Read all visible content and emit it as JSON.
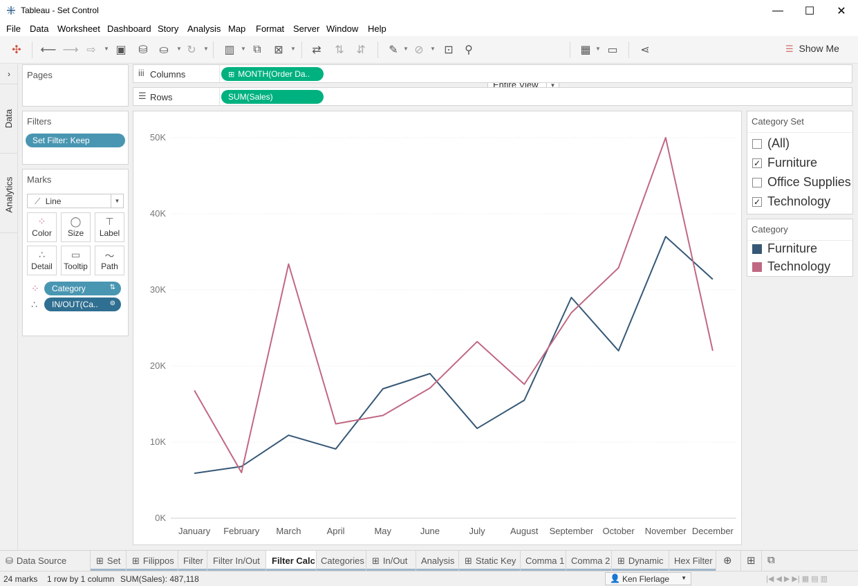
{
  "window": {
    "title": "Tableau - Set Control",
    "controls": {
      "minimize": "—",
      "maximize": "☐",
      "close": "✕"
    }
  },
  "menu": [
    "File",
    "Data",
    "Worksheet",
    "Dashboard",
    "Story",
    "Analysis",
    "Map",
    "Format",
    "Server",
    "Window",
    "Help"
  ],
  "toolbar": {
    "fit_value": "Entire View",
    "show_me": "Show Me"
  },
  "side_tabs": {
    "data": "Data",
    "analytics": "Analytics"
  },
  "pages_card": {
    "title": "Pages"
  },
  "filters_card": {
    "title": "Filters",
    "pills": [
      "Set Filter: Keep"
    ]
  },
  "marks_card": {
    "title": "Marks",
    "mark_type": "Line",
    "buttons": [
      "Color",
      "Size",
      "Label",
      "Detail",
      "Tooltip",
      "Path"
    ],
    "fields": [
      {
        "label": "Category",
        "encoding": "color"
      },
      {
        "label": "IN/OUT(Ca..",
        "encoding": "detail"
      }
    ]
  },
  "shelves": {
    "columns": {
      "label": "Columns",
      "pill": "MONTH(Order Da.."
    },
    "rows": {
      "label": "Rows",
      "pill": "SUM(Sales)"
    }
  },
  "category_set_legend": {
    "title": "Category Set",
    "items": [
      {
        "label": "(All)",
        "checked": false
      },
      {
        "label": "Furniture",
        "checked": true
      },
      {
        "label": "Office Supplies",
        "checked": false
      },
      {
        "label": "Technology",
        "checked": true
      }
    ]
  },
  "category_legend": {
    "title": "Category",
    "items": [
      {
        "label": "Furniture",
        "color": "#365876"
      },
      {
        "label": "Technology",
        "color": "#c06882"
      }
    ]
  },
  "chart_data": {
    "type": "line",
    "categories": [
      "January",
      "February",
      "March",
      "April",
      "May",
      "June",
      "July",
      "August",
      "September",
      "October",
      "November",
      "December"
    ],
    "series": [
      {
        "name": "Furniture",
        "color": "#365876",
        "values": [
          5900,
          6800,
          10900,
          9100,
          17000,
          19000,
          11800,
          15500,
          29000,
          22000,
          37000,
          31400
        ]
      },
      {
        "name": "Technology",
        "color": "#c06882",
        "values": [
          16800,
          6000,
          33400,
          12400,
          13500,
          17100,
          23200,
          17600,
          27000,
          32900,
          50000,
          22000
        ]
      }
    ],
    "ylim": [
      0,
      50000
    ],
    "yticks": [
      "0K",
      "10K",
      "20K",
      "30K",
      "40K",
      "50K"
    ],
    "ytick_values": [
      0,
      10000,
      20000,
      30000,
      40000,
      50000
    ],
    "grid": true
  },
  "sheet_tabs": [
    {
      "label": "Data Source",
      "icon": "datasource"
    },
    {
      "label": "Set",
      "icon": "sheet"
    },
    {
      "label": "Filippos",
      "icon": "sheet"
    },
    {
      "label": "Filter",
      "icon": ""
    },
    {
      "label": "Filter In/Out",
      "icon": ""
    },
    {
      "label": "Filter Calc",
      "icon": "",
      "active": true
    },
    {
      "label": "Categories",
      "icon": ""
    },
    {
      "label": "In/Out",
      "icon": "sheet"
    },
    {
      "label": "Analysis",
      "icon": ""
    },
    {
      "label": "Static Key",
      "icon": "sheet"
    },
    {
      "label": "Comma 1",
      "icon": ""
    },
    {
      "label": "Comma 2",
      "icon": ""
    },
    {
      "label": "Dynamic",
      "icon": "sheet"
    },
    {
      "label": "Hex Filter",
      "icon": ""
    }
  ],
  "status": {
    "marks": "24 marks",
    "rows_cols": "1 row by 1 column",
    "sum": "SUM(Sales): 487,118",
    "user": "Ken Flerlage"
  }
}
